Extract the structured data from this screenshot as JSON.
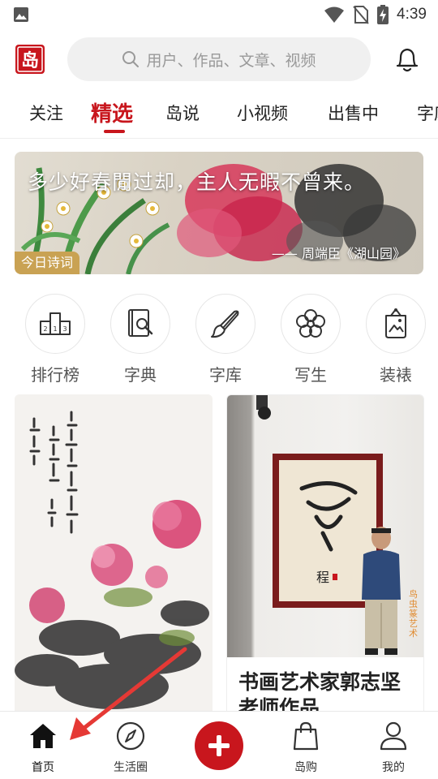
{
  "status_bar": {
    "time": "4:39",
    "icons": [
      "gallery-icon",
      "wifi-icon",
      "no-sim-icon",
      "battery-charging-icon"
    ]
  },
  "header": {
    "logo": "岛",
    "search_placeholder": "用户、作品、文章、视频",
    "bell_icon": "bell-icon"
  },
  "tabs": [
    {
      "label": "关注"
    },
    {
      "label": "精选",
      "active": true
    },
    {
      "label": "岛说"
    },
    {
      "label": "小视频"
    },
    {
      "label": "出售中"
    },
    {
      "label": "字库"
    }
  ],
  "banner": {
    "poem": "多少好春閒过却，主人无暇不曾来。",
    "source": "—— 周端臣《湖山园》",
    "tag": "今日诗词"
  },
  "categories": [
    {
      "label": "排行榜",
      "icon": "podium-icon"
    },
    {
      "label": "字典",
      "icon": "dictionary-icon"
    },
    {
      "label": "字库",
      "icon": "brush-icon"
    },
    {
      "label": "写生",
      "icon": "flower-icon"
    },
    {
      "label": "装裱",
      "icon": "frame-icon"
    }
  ],
  "cards": [
    {
      "image": "peony-ink-painting"
    },
    {
      "image": "calligraphy-exhibition-photo",
      "side_label": "鸟虫篆艺术",
      "title": "书画艺术家郭志坚老师作品"
    }
  ],
  "bottom_nav": [
    {
      "label": "首页",
      "icon": "home-icon",
      "active": true
    },
    {
      "label": "生活圈",
      "icon": "compass-icon"
    },
    {
      "label": "",
      "icon": "plus-icon"
    },
    {
      "label": "岛购",
      "icon": "shopping-bag-icon"
    },
    {
      "label": "我的",
      "icon": "person-icon"
    }
  ],
  "colors": {
    "accent": "#c8161d",
    "tag_gold": "#c9a253",
    "search_bg": "#f0f0f0"
  }
}
